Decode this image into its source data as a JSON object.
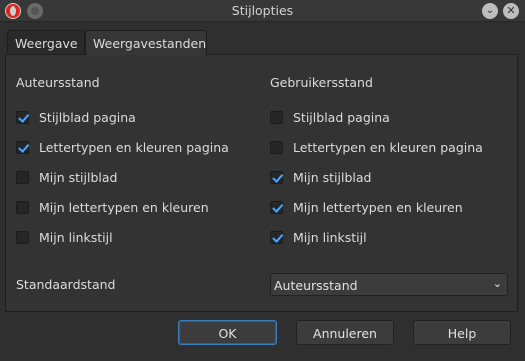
{
  "window": {
    "title": "Stijlopties"
  },
  "tabs": [
    {
      "label": "Weergave"
    },
    {
      "label": "Weergavestanden"
    }
  ],
  "author": {
    "heading": "Auteursstand",
    "items": [
      {
        "label": "Stijlblad pagina",
        "checked": true
      },
      {
        "label": "Lettertypen en kleuren pagina",
        "checked": true
      },
      {
        "label": "Mijn stijlblad",
        "checked": false
      },
      {
        "label": "Mijn lettertypen en kleuren",
        "checked": false
      },
      {
        "label": "Mijn linkstijl",
        "checked": false
      }
    ]
  },
  "user": {
    "heading": "Gebruikersstand",
    "items": [
      {
        "label": "Stijlblad pagina",
        "checked": false
      },
      {
        "label": "Lettertypen en kleuren pagina",
        "checked": false
      },
      {
        "label": "Mijn stijlblad",
        "checked": true
      },
      {
        "label": "Mijn lettertypen en kleuren",
        "checked": true
      },
      {
        "label": "Mijn linkstijl",
        "checked": true
      }
    ]
  },
  "default_mode": {
    "label": "Standaardstand",
    "selected": "Auteursstand"
  },
  "buttons": {
    "ok": "OK",
    "cancel": "Annuleren",
    "help": "Help"
  },
  "colors": {
    "accent": "#4da6ff",
    "background": "#2f2f2f",
    "opera_red": "#e0261b"
  }
}
